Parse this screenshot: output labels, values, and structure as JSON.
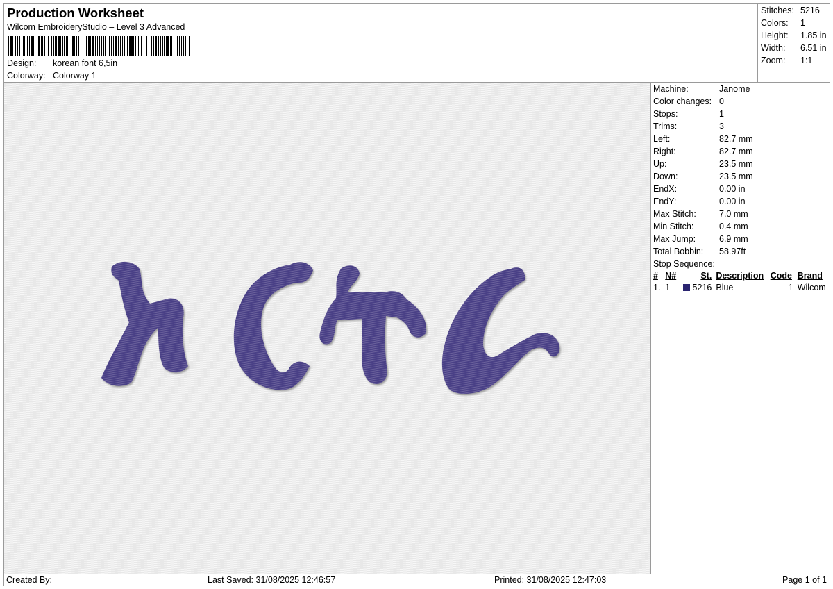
{
  "header": {
    "title": "Production Worksheet",
    "subtitle": "Wilcom EmbroideryStudio – Level 3 Advanced",
    "design_label": "Design:",
    "design_value": "korean font 6,5in",
    "colorway_label": "Colorway:",
    "colorway_value": "Colorway 1"
  },
  "summary": [
    {
      "label": "Stitches:",
      "value": "5216"
    },
    {
      "label": "Colors:",
      "value": "1"
    },
    {
      "label": "Height:",
      "value": "1.85 in"
    },
    {
      "label": "Width:",
      "value": "6.51 in"
    },
    {
      "label": "Zoom:",
      "value": "1:1"
    }
  ],
  "machine_info": [
    {
      "label": "Machine:",
      "value": "Janome"
    },
    {
      "label": "Color changes:",
      "value": "0"
    },
    {
      "label": "Stops:",
      "value": "1"
    },
    {
      "label": "Trims:",
      "value": "3"
    },
    {
      "label": "Left:",
      "value": "82.7 mm"
    },
    {
      "label": "Right:",
      "value": "82.7 mm"
    },
    {
      "label": "Up:",
      "value": "23.5 mm"
    },
    {
      "label": "Down:",
      "value": "23.5 mm"
    },
    {
      "label": "EndX:",
      "value": "0.00 in"
    },
    {
      "label": "EndY:",
      "value": "0.00 in"
    },
    {
      "label": "Max Stitch:",
      "value": "7.0 mm"
    },
    {
      "label": "Min Stitch:",
      "value": "0.4 mm"
    },
    {
      "label": "Max Jump:",
      "value": "6.9 mm"
    },
    {
      "label": "Total Bobbin:",
      "value": "58.97ft"
    }
  ],
  "stop_sequence": {
    "label": "Stop Sequence:",
    "headers": [
      "#",
      "N#",
      "St.",
      "Description",
      "Code",
      "Brand"
    ],
    "rows": [
      {
        "index": "1.",
        "n": "1",
        "color": "#2a2470",
        "stitches": "5216",
        "description": "Blue",
        "code": "1",
        "brand": "Wilcom"
      }
    ]
  },
  "design_preview": {
    "text": "ኤርትራ",
    "thread_color": "#4a3f86"
  },
  "footer": {
    "created_by": "Created By:",
    "last_saved": "Last Saved: 31/08/2025 12:46:57",
    "printed": "Printed: 31/08/2025 12:47:03",
    "page": "Page 1 of 1"
  }
}
